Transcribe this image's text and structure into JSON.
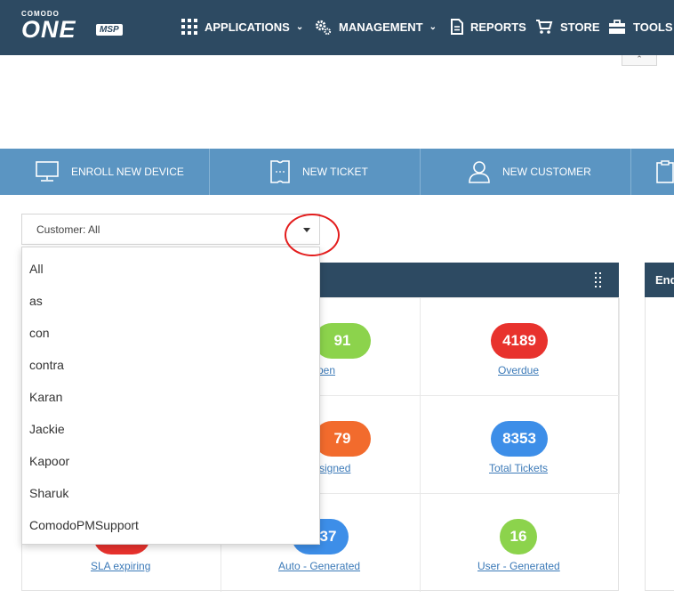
{
  "brand": {
    "company": "COMODO",
    "product": "ONE",
    "badge": "MSP"
  },
  "nav": {
    "applications": "APPLICATIONS",
    "management": "MANAGEMENT",
    "reports": "REPORTS",
    "store": "STORE",
    "tools": "TOOLS"
  },
  "actions": {
    "enroll": "ENROLL NEW DEVICE",
    "ticket": "NEW TICKET",
    "customer": "NEW CUSTOMER"
  },
  "customer_filter": {
    "value": "Customer: All",
    "options": [
      "All",
      "as",
      "con",
      "contra",
      "Karan",
      "Jackie",
      "Kapoor",
      "Sharuk",
      "ComodoPMSupport"
    ]
  },
  "tickets_widget": {
    "metrics": [
      {
        "value": "91",
        "label": "pen",
        "color": "#8cd34c"
      },
      {
        "value": "4189",
        "label": "Overdue",
        "color": "#e8322d"
      },
      {
        "value": "79",
        "label": "signed",
        "color": "#f26b2d"
      },
      {
        "value": "8353",
        "label": "Total Tickets",
        "color": "#3d8ee8"
      },
      {
        "value": "",
        "label": "SLA expiring",
        "color": "#e8322d"
      },
      {
        "value": "37",
        "label": "Auto - Generated",
        "color": "#3d8ee8"
      },
      {
        "value": "16",
        "label": "User - Generated",
        "color": "#8cd34c"
      }
    ]
  },
  "right_panel": {
    "title": "End"
  }
}
